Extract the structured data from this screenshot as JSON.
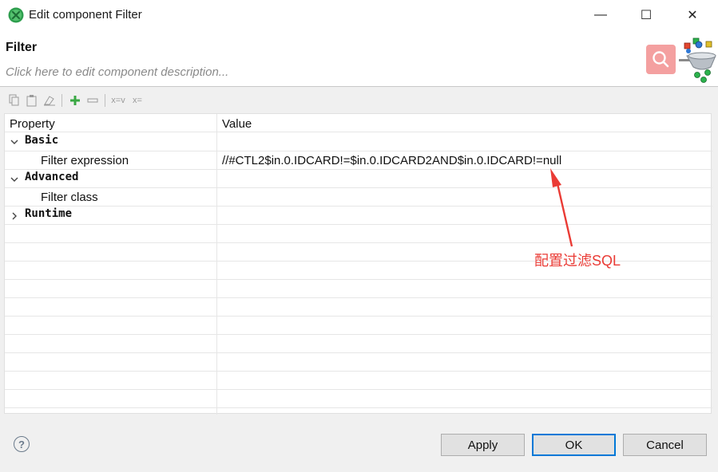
{
  "window": {
    "title": "Edit component Filter",
    "controls": {
      "minimize": "—",
      "maximize": "☐",
      "close": "✕"
    }
  },
  "header": {
    "title": "Filter",
    "description_placeholder": "Click here to edit component description..."
  },
  "toolbar": {
    "buttons": [
      {
        "icon": "copy-icon"
      },
      {
        "icon": "paste-icon"
      },
      {
        "icon": "clear-icon"
      },
      {
        "icon": "add-icon"
      },
      {
        "icon": "remove-icon"
      },
      {
        "icon": "x-equals-icon",
        "label": "x=v"
      },
      {
        "icon": "x-assign-icon",
        "label": "x="
      }
    ]
  },
  "table": {
    "columns": [
      "Property",
      "Value"
    ],
    "rows": [
      {
        "type": "group",
        "label": "Basic",
        "expanded": true
      },
      {
        "type": "prop",
        "label": "Filter expression",
        "value": "//#CTL2$in.0.IDCARD!=$in.0.IDCARD2AND$in.0.IDCARD!=null"
      },
      {
        "type": "group",
        "label": "Advanced",
        "expanded": true
      },
      {
        "type": "prop",
        "label": "Filter class",
        "value": ""
      },
      {
        "type": "group",
        "label": "Runtime",
        "expanded": false
      }
    ]
  },
  "annotation": {
    "text": "配置过滤SQL",
    "color": "#ea3b35"
  },
  "footer": {
    "help_label": "?",
    "apply_label": "Apply",
    "ok_label": "OK",
    "cancel_label": "Cancel"
  },
  "colors": {
    "accent": "#0078d7",
    "annotation": "#ea3b35",
    "badge": "#f4a0a0"
  }
}
